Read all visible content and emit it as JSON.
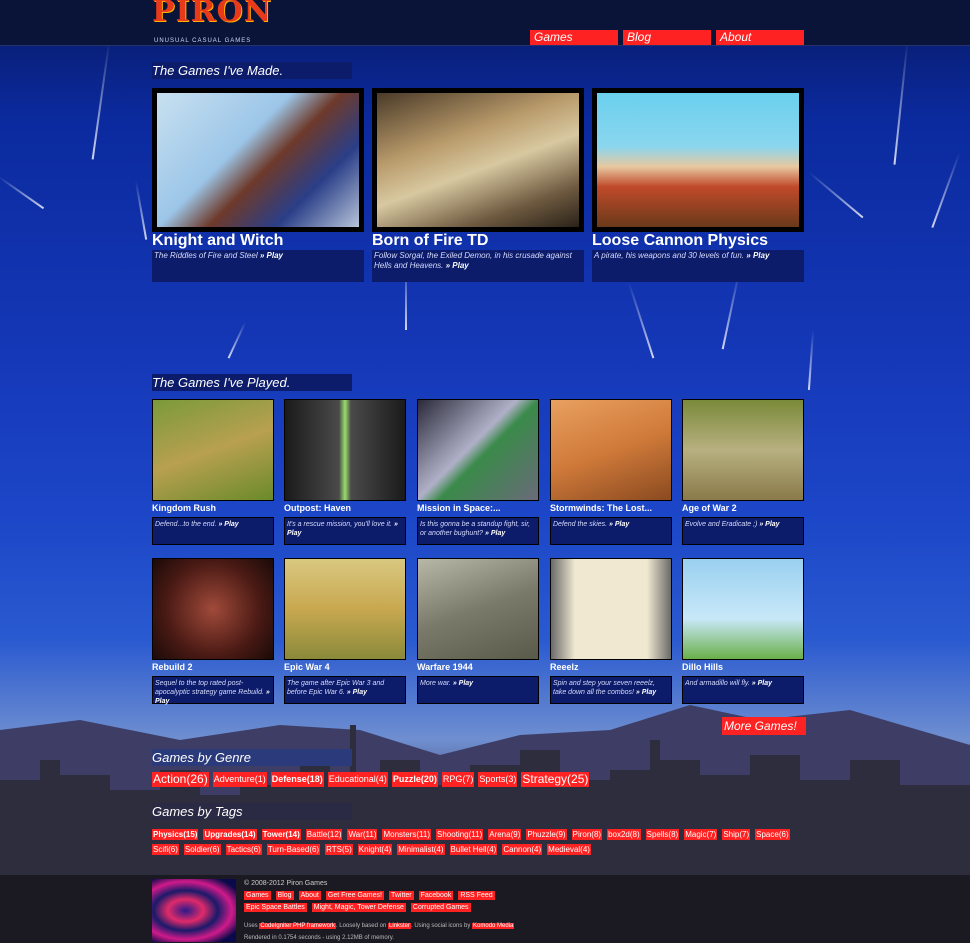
{
  "brand": {
    "name": "PIRON",
    "tagline": "UNUSUAL CASUAL GAMES"
  },
  "nav": [
    {
      "label": "Games"
    },
    {
      "label": "Blog"
    },
    {
      "label": "About"
    }
  ],
  "made_section": {
    "title": "The Games I've Made.",
    "games": [
      {
        "name": "Knight and Witch",
        "desc": "The Riddles of Fire and Steel",
        "play": "» Play"
      },
      {
        "name": "Born of Fire TD",
        "desc": "Follow Sorgal, the Exiled Demon, in his crusade against Hells and Heavens.",
        "play": "» Play"
      },
      {
        "name": "Loose Cannon Physics",
        "desc": "A pirate, his weapons and 30 levels of fun.",
        "play": "» Play"
      }
    ]
  },
  "played_section": {
    "title": "The Games I've Played.",
    "games": [
      {
        "name": "Kingdom Rush",
        "desc": "Defend...to the end.",
        "play": "» Play"
      },
      {
        "name": "Outpost: Haven",
        "desc": "It's a rescue mission, you'll love it.",
        "play": "» Play"
      },
      {
        "name": "Mission in Space:...",
        "desc": "Is this gonna be a standup fight, sir, or another bughunt?",
        "play": "» Play"
      },
      {
        "name": "Stormwinds: The Lost...",
        "desc": "Defend the skies.",
        "play": "» Play"
      },
      {
        "name": "Age of War 2",
        "desc": "Evolve and Eradicate ;)",
        "play": "» Play"
      },
      {
        "name": "Rebuild 2",
        "desc": "Sequel to the top rated post-apocalyptic strategy game Rebuild.",
        "play": "» Play"
      },
      {
        "name": "Epic War 4",
        "desc": "The game after Epic War 3 and before Epic War 6.",
        "play": "» Play"
      },
      {
        "name": "Warfare 1944",
        "desc": "More war.",
        "play": "» Play"
      },
      {
        "name": "Reeelz",
        "desc": "Spin and step your seven reeelz, take down all the combos!",
        "play": "» Play"
      },
      {
        "name": "Dillo Hills",
        "desc": "And armadillo will fly.",
        "play": "» Play"
      }
    ],
    "more_label": "More Games!"
  },
  "genres": {
    "title": "Games by Genre",
    "items": [
      {
        "label": "Action(26)",
        "size": "12px",
        "bold": false
      },
      {
        "label": "Adventure(1)",
        "size": "9px",
        "bold": false
      },
      {
        "label": "Defense(18)",
        "size": "9px",
        "bold": true
      },
      {
        "label": "Educational(4)",
        "size": "9px",
        "bold": false
      },
      {
        "label": "Puzzle(20)",
        "size": "9px",
        "bold": true
      },
      {
        "label": "RPG(7)",
        "size": "9px",
        "bold": false
      },
      {
        "label": "Sports(3)",
        "size": "9px",
        "bold": false
      },
      {
        "label": "Strategy(25)",
        "size": "12px",
        "bold": false
      }
    ]
  },
  "tags": {
    "title": "Games by Tags",
    "items": [
      {
        "label": "Physics(15)",
        "bold": true
      },
      {
        "label": "Upgrades(14)",
        "bold": true
      },
      {
        "label": "Tower(14)",
        "bold": true
      },
      {
        "label": "Battle(12)",
        "bold": false
      },
      {
        "label": "War(11)",
        "bold": false
      },
      {
        "label": "Monsters(11)",
        "bold": false
      },
      {
        "label": "Shooting(11)",
        "bold": false
      },
      {
        "label": "Arena(9)",
        "bold": false
      },
      {
        "label": "Phuzzle(9)",
        "bold": false
      },
      {
        "label": "Piron(8)",
        "bold": false
      },
      {
        "label": "box2d(8)",
        "bold": false
      },
      {
        "label": "Spells(8)",
        "bold": false
      },
      {
        "label": "Magic(7)",
        "bold": false
      },
      {
        "label": "Ship(7)",
        "bold": false
      },
      {
        "label": "Space(6)",
        "bold": false
      },
      {
        "label": "Scifi(6)",
        "bold": false
      },
      {
        "label": "Soldier(6)",
        "bold": false
      },
      {
        "label": "Tactics(6)",
        "bold": false
      },
      {
        "label": "Turn-Based(6)",
        "bold": false
      },
      {
        "label": "RTS(5)",
        "bold": false
      },
      {
        "label": "Knight(4)",
        "bold": false
      },
      {
        "label": "Minimalist(4)",
        "bold": false
      },
      {
        "label": "Bullet Hell(4)",
        "bold": false
      },
      {
        "label": "Cannon(4)",
        "bold": false
      },
      {
        "label": "Medieval(4)",
        "bold": false
      }
    ]
  },
  "footer": {
    "copyright": "© 2008-2012 Piron Games",
    "links": [
      {
        "label": "Games"
      },
      {
        "label": "Blog"
      },
      {
        "label": "About"
      },
      {
        "label": "Get Free Games!"
      },
      {
        "label": "Twitter"
      },
      {
        "label": "Facebook"
      },
      {
        "label": "RSS Feed"
      },
      {
        "label": "Epic Space Battles"
      },
      {
        "label": "Might, Magic, Tower Defense"
      },
      {
        "label": "Corrupted Games"
      }
    ],
    "uses_prefix": "Uses",
    "uses_link": "CodeIgniter PHP framework",
    "loosely": ". Loosely based on",
    "linkster": "Linkster",
    "social": ". Using social icons by",
    "komodo": "Komodo Media",
    "rendered": "Rendered in 0.1754 seconds - using 2.12MB of memory."
  }
}
